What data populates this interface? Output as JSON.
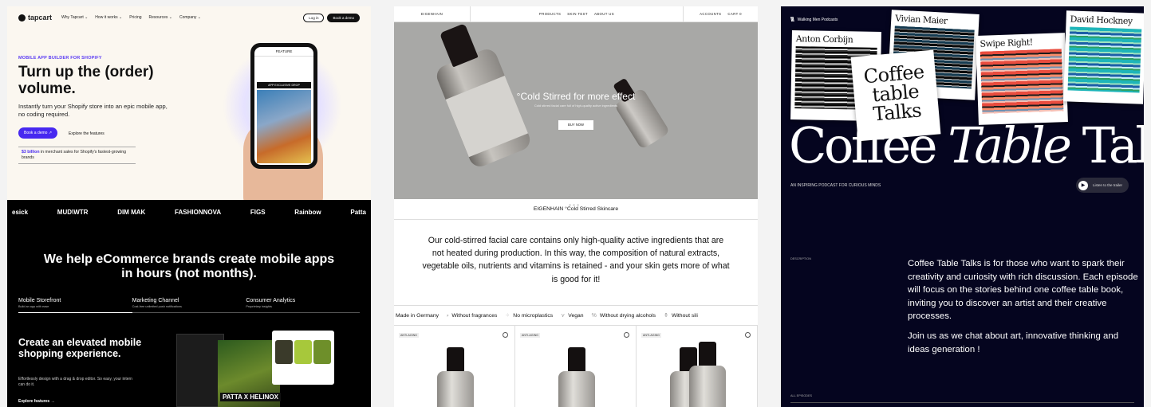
{
  "tapcart": {
    "logo": "tapcart",
    "nav": [
      "Why Tapcart ⌄",
      "How it works ⌄",
      "Pricing",
      "Resources ⌄",
      "Company ⌄"
    ],
    "login": "Log in",
    "book_demo_nav": "Book a demo",
    "eyebrow": "MOBILE APP BUILDER FOR SHOPIFY",
    "headline": "Turn up the (order) volume.",
    "subhead": "Instantly turn your Shopify store into an epic mobile app, no coding required.",
    "cta": "Book a demo ↗",
    "secondary": "Explore the features",
    "stat_value": "$3 billion",
    "stat_text": " in merchant sales for Shopify's fastest-growing brands",
    "phone_header": "FEATURE",
    "phone_drop": "APP EXCLUSIVE DROP",
    "brands": [
      "esick",
      "MUD\\WTR",
      "DIM MAK",
      "FASHIONNOVA",
      "FIGS",
      "Rainbow",
      "Patta"
    ],
    "big_headline": "We help eCommerce brands create mobile apps in hours (not months).",
    "tabs": [
      {
        "label": "Mobile Storefront",
        "sub": "Build an app with ease"
      },
      {
        "label": "Marketing Channel",
        "sub": "Cost-free unlimited push notifications"
      },
      {
        "label": "Consumer Analytics",
        "sub": "Proprietary insights"
      }
    ],
    "h2": "Create an elevated mobile shopping experience.",
    "p2": "Effortlessly design with a drag & drop editor. So easy, your intern can do it.",
    "explore": "Explore features →",
    "mock_banner": "PATTA X HELINOX"
  },
  "eigenhain": {
    "brand": "EIGENHAIN",
    "links": [
      "PRODUCTS",
      "SKIN TEST",
      "ABOUT US"
    ],
    "account": [
      "ACCOUNTS",
      "CART 0"
    ],
    "hero_title": "°Cold Stirred for more effect",
    "hero_sub": "Cold stirred facial care full of high-quality active ingredients",
    "buy": "BUY NOW",
    "strip": "EIGENHAIN °Cold Stirred Skincare",
    "copy": "Our cold-stirred facial care contains only high-quality active ingredients that are not heated during production. In this way, the composition of natural extracts, vegetable oils, nutrients and vitamins is retained - and your skin gets more of what is good for it!",
    "features": [
      {
        "icon": "",
        "label": "Made in Germany"
      },
      {
        "icon": "⸗",
        "label": "Without fragrances"
      },
      {
        "icon": "⁘",
        "label": "No microplastics"
      },
      {
        "icon": "⋎",
        "label": "Vegan"
      },
      {
        "icon": "%",
        "label": "Without drying alcohols"
      },
      {
        "icon": "⚱",
        "label": "Without sili"
      }
    ],
    "tags": [
      "ANTI-AGING",
      "ANTI-AGING",
      "ANTI-AGING"
    ]
  },
  "coffee": {
    "brand_mark": "\\\\\\",
    "brand": "Walking Men Podcasts",
    "covers": [
      "Anton Corbijn",
      "Vivian Maier",
      "Swipe Right!",
      "David Hockney",
      "Coffee table Talks"
    ],
    "title_a": "Coffee ",
    "title_b": "Table",
    "title_c": " Talks",
    "tagline": "AN INSPIRING PODCAST FOR CURIOUS MINDS",
    "trailer": "Listen to the trailer",
    "desc_label": "DESCRIPTION",
    "desc_1": "Coffee Table Talks is for those who want to spark their creativity and curiosity with rich discussion. Each episode will focus on the stories behind one coffee table book, inviting you to discover an artist and their creative processes.",
    "desc_2": "Join us as we chat about art, innovative thinking and ideas generation !",
    "all_label": "ALL EPISODES"
  }
}
